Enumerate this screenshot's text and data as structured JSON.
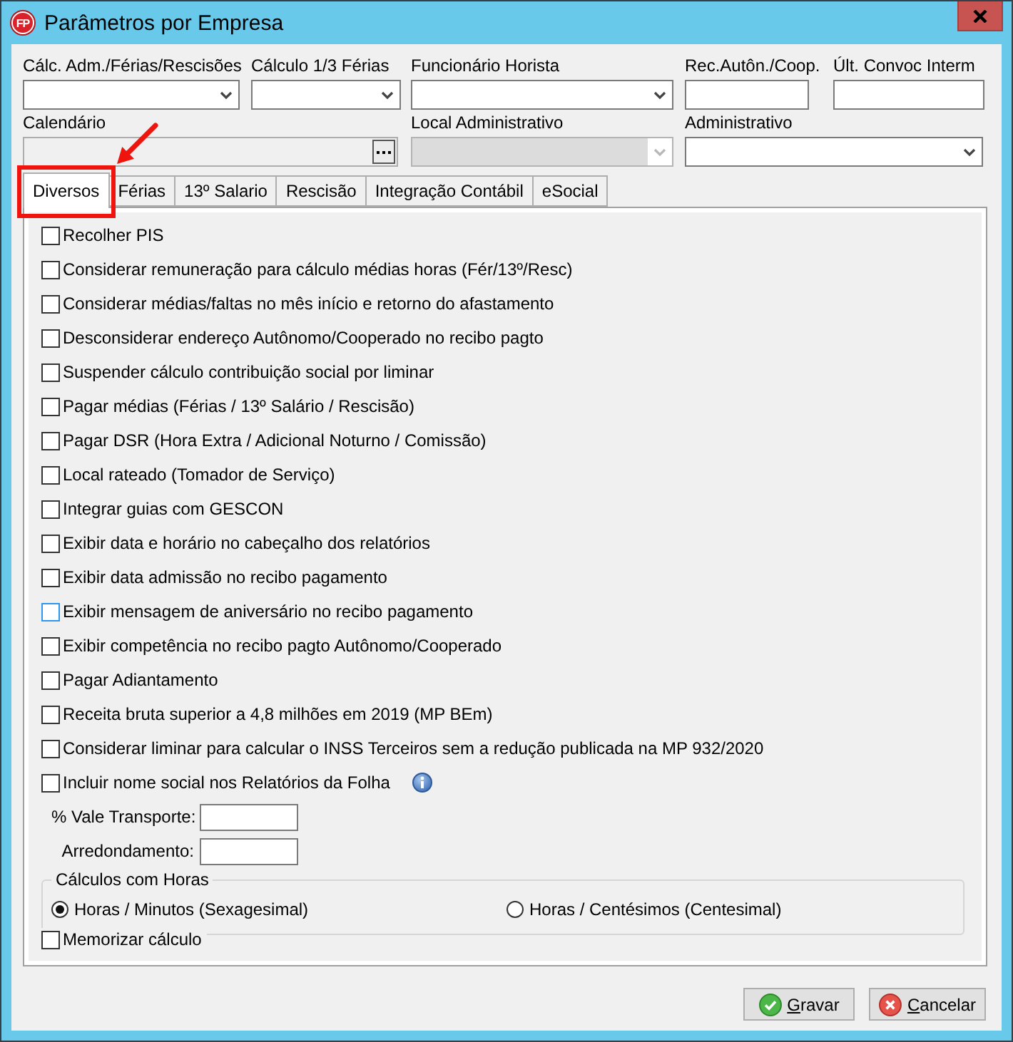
{
  "window": {
    "title": "Parâmetros por Empresa",
    "logo": "FP"
  },
  "field_rows": [
    [
      {
        "label": "Cálc. Adm./Férias/Rescisões",
        "kind": "dropdown",
        "disabled": false
      },
      {
        "label": "Cálculo 1/3 Férias",
        "kind": "dropdown",
        "disabled": false
      },
      {
        "label": "Funcionário Horista",
        "kind": "dropdown",
        "disabled": false
      },
      {
        "label": "Rec.Autôn./Coop.",
        "kind": "text",
        "disabled": false
      },
      {
        "label": "Últ. Convoc Interm",
        "kind": "text",
        "disabled": false
      }
    ],
    [
      {
        "label": "Calendário",
        "kind": "lookup",
        "disabled": false
      },
      {
        "label": "Local Administrativo",
        "kind": "dropdown",
        "disabled": true
      },
      {
        "label": "Administrativo",
        "kind": "dropdown",
        "disabled": false
      }
    ]
  ],
  "tabs": [
    {
      "label": "Diversos",
      "selected": true
    },
    {
      "label": "Férias",
      "selected": false
    },
    {
      "label": "13º Salario",
      "selected": false
    },
    {
      "label": "Rescisão",
      "selected": false
    },
    {
      "label": "Integração Contábil",
      "selected": false
    },
    {
      "label": "eSocial",
      "selected": false
    }
  ],
  "options": [
    {
      "label": "Recolher PIS",
      "checked": false,
      "focused": false,
      "info": false
    },
    {
      "label": "Considerar remuneração para cálculo médias horas (Fér/13º/Resc)",
      "checked": false,
      "focused": false,
      "info": false
    },
    {
      "label": "Considerar médias/faltas no mês início e retorno do afastamento",
      "checked": false,
      "focused": false,
      "info": false
    },
    {
      "label": "Desconsiderar endereço Autônomo/Cooperado no recibo pagto",
      "checked": false,
      "focused": false,
      "info": false
    },
    {
      "label": "Suspender cálculo contribuição social por liminar",
      "checked": false,
      "focused": false,
      "info": false
    },
    {
      "label": "Pagar médias (Férias / 13º Salário / Rescisão)",
      "checked": false,
      "focused": false,
      "info": false
    },
    {
      "label": "Pagar DSR (Hora Extra / Adicional Noturno / Comissão)",
      "checked": false,
      "focused": false,
      "info": false
    },
    {
      "label": "Local rateado (Tomador de Serviço)",
      "checked": false,
      "focused": false,
      "info": false
    },
    {
      "label": "Integrar guias com GESCON",
      "checked": false,
      "focused": false,
      "info": false
    },
    {
      "label": "Exibir data e horário no cabeçalho dos relatórios",
      "checked": false,
      "focused": false,
      "info": false
    },
    {
      "label": "Exibir data admissão no recibo pagamento",
      "checked": false,
      "focused": false,
      "info": false
    },
    {
      "label": "Exibir mensagem de aniversário no recibo pagamento",
      "checked": false,
      "focused": true,
      "info": false
    },
    {
      "label": "Exibir competência no recibo pagto Autônomo/Cooperado",
      "checked": false,
      "focused": false,
      "info": false
    },
    {
      "label": "Pagar Adiantamento",
      "checked": false,
      "focused": false,
      "info": false
    },
    {
      "label": "Receita bruta superior a 4,8 milhões em 2019 (MP BEm)",
      "checked": false,
      "focused": false,
      "info": false
    },
    {
      "label": "Considerar liminar para calcular o INSS Terceiros sem a redução publicada na MP 932/2020",
      "checked": false,
      "focused": false,
      "info": false
    },
    {
      "label": "Incluir nome social nos Relatórios da Folha",
      "checked": false,
      "focused": false,
      "info": true
    }
  ],
  "numeric_fields": [
    {
      "label": "% Vale Transporte:"
    },
    {
      "label": "Arredondamento:"
    }
  ],
  "hours_group": {
    "title": "Cálculos com Horas",
    "options": [
      {
        "label": "Horas / Minutos (Sexagesimal)",
        "selected": true
      },
      {
        "label": "Horas / Centésimos (Centesimal)",
        "selected": false
      }
    ]
  },
  "memorize": {
    "label": "Memorizar cálculo",
    "checked": false
  },
  "buttons": [
    {
      "label": "Gravar",
      "kind": "save"
    },
    {
      "label": "Cancelar",
      "kind": "cancel"
    }
  ]
}
